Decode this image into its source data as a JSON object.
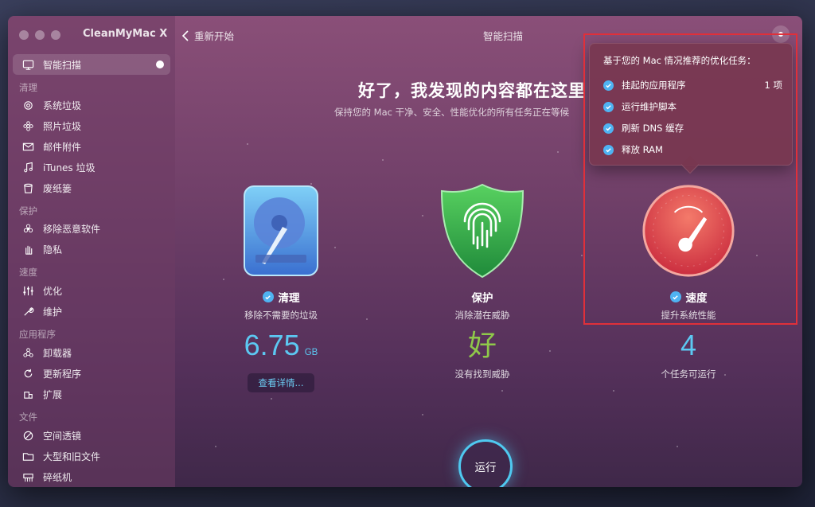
{
  "app": {
    "title": "CleanMyMac X"
  },
  "toolbar": {
    "back_label": "重新开始",
    "window_title": "智能扫描"
  },
  "sidebar": {
    "active": {
      "label": "智能扫描"
    },
    "sections": [
      {
        "label": "清理",
        "items": [
          "系统垃圾",
          "照片垃圾",
          "邮件附件",
          "iTunes 垃圾",
          "废纸篓"
        ]
      },
      {
        "label": "保护",
        "items": [
          "移除恶意软件",
          "隐私"
        ]
      },
      {
        "label": "速度",
        "items": [
          "优化",
          "维护"
        ]
      },
      {
        "label": "应用程序",
        "items": [
          "卸载器",
          "更新程序",
          "扩展"
        ]
      },
      {
        "label": "文件",
        "items": [
          "空间透镜",
          "大型和旧文件",
          "碎纸机"
        ]
      }
    ]
  },
  "main": {
    "headline": "好了，我发现的内容都在这里",
    "subline": "保持您的 Mac 干净、安全、性能优化的所有任务正在等候",
    "modules": {
      "clean": {
        "title": "清理",
        "subtitle": "移除不需要的垃圾",
        "value": "6.75",
        "unit": "GB",
        "button": "查看详情..."
      },
      "protect": {
        "title": "保护",
        "subtitle": "消除潜在威胁",
        "value": "好",
        "note": "没有找到威胁"
      },
      "speed": {
        "title": "速度",
        "subtitle": "提升系统性能",
        "value": "4",
        "note": "个任务可运行"
      }
    },
    "run_button": "运行"
  },
  "popover": {
    "title": "基于您的 Mac 情况推荐的优化任务：",
    "items": [
      {
        "label": "挂起的应用程序",
        "count": "1 项"
      },
      {
        "label": "运行维护脚本"
      },
      {
        "label": "刷新 DNS 缓存"
      },
      {
        "label": "释放 RAM"
      }
    ]
  },
  "colors": {
    "accent_blue": "#4fb3f2",
    "value_blue": "#5cc8f2",
    "value_green": "#8fc94a",
    "highlight_red": "#e0303a"
  }
}
